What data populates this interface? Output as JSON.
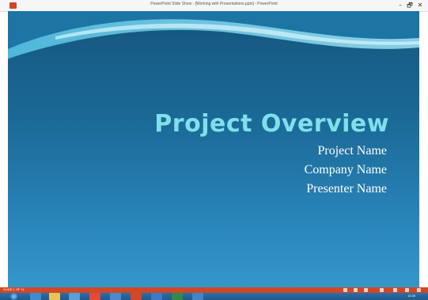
{
  "window": {
    "title": "PowerPoint Slide Show - [Working with Presentations.pptx] - PowerPoint",
    "app_icon": "powerpoint-icon",
    "minimize": "–",
    "restore": "🗗",
    "close": "✕"
  },
  "slide": {
    "title": "Project Overview",
    "lines": [
      "Project Name",
      "Company Name",
      "Presenter Name"
    ]
  },
  "status": {
    "slide_counter": "SLIDE 1 OF 11",
    "icons": [
      "notes-icon",
      "comments-icon",
      "normal-view-icon",
      "slide-sorter-icon",
      "reading-view-icon",
      "slideshow-icon",
      "zoom-icon"
    ]
  },
  "taskbar": {
    "apps": [
      "file-explorer-icon",
      "folder-icon",
      "media-player-icon",
      "chrome-icon",
      "powerpoint-icon",
      "word-icon",
      "excel-icon",
      "outlook-icon"
    ],
    "clock": "11:05"
  },
  "colors": {
    "accent": "#d24726",
    "title": "#7fe0ea",
    "slide_top": "#15567e",
    "slide_bottom": "#3696c9"
  }
}
